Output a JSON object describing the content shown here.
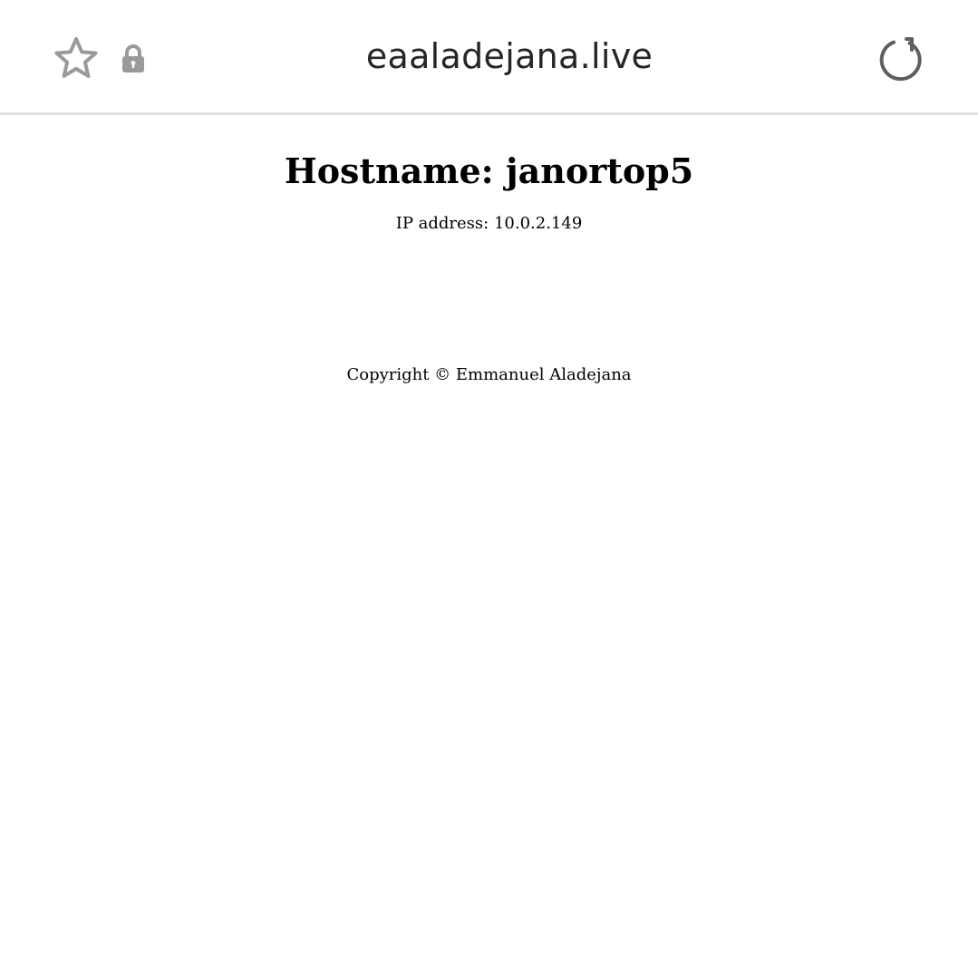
{
  "browser": {
    "url": "eaaladejana.live",
    "icons": {
      "bookmark": "star-icon",
      "security": "lock-icon",
      "reload": "reload-icon"
    },
    "icon_color": "#9a9a9a",
    "reload_color": "#5f5f5f"
  },
  "page": {
    "hostname_heading": "Hostname: janortop5",
    "ip_text": "IP address: 10.0.2.149",
    "footer": "Copyright © Emmanuel Aladejana"
  }
}
